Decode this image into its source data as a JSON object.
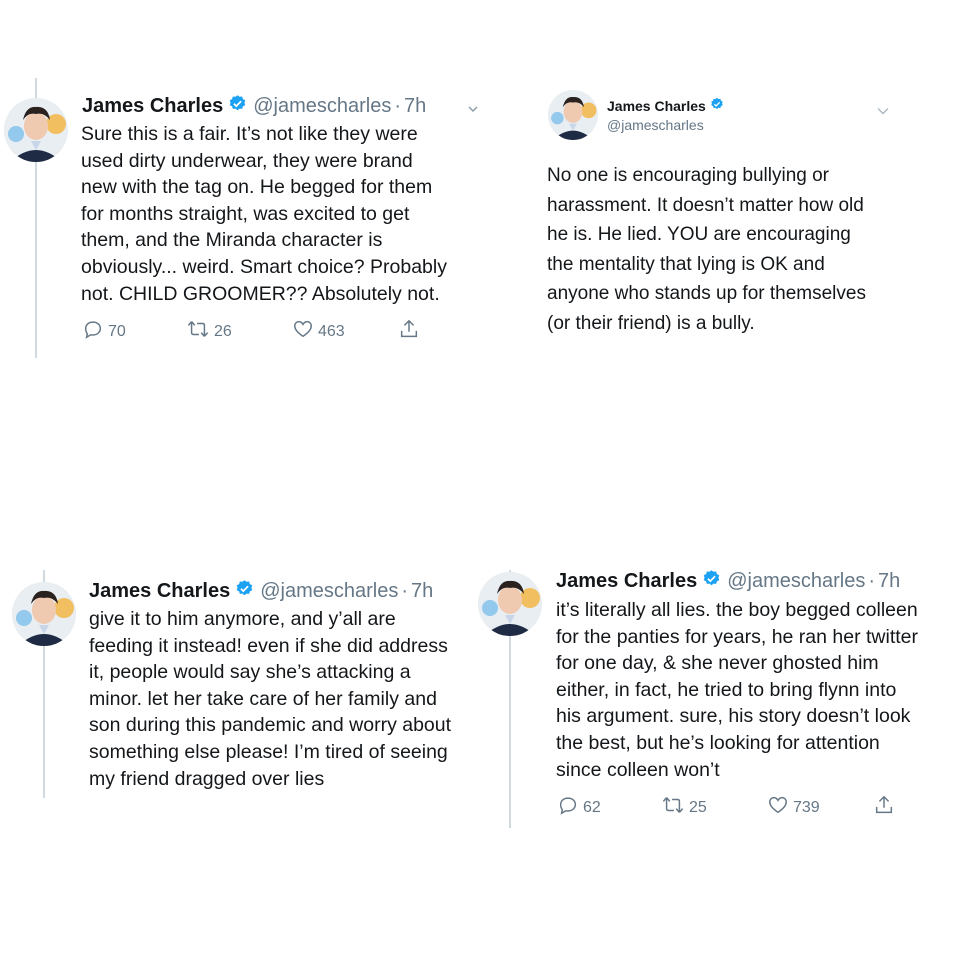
{
  "tweets": [
    {
      "name": "James Charles",
      "handle": "@jamescharles",
      "dot": "·",
      "time": "7h",
      "lines": [
        "Sure this is a fair. It’s not like they were",
        "used dirty underwear, they were brand",
        "new with the tag on. He begged for them",
        "for months straight, was excited to get",
        "them, and the Miranda character is",
        "obviously... weird. Smart choice? Probably",
        "not. CHILD GROOMER?? Absolutely not."
      ],
      "replies": "70",
      "retweets": "26",
      "likes": "463"
    },
    {
      "name": "James Charles",
      "handle": "@jamescharles",
      "lines": [
        "No one is encouraging bullying or",
        "harassment. It doesn’t matter how old",
        "he is. He lied. YOU are encouraging",
        "the mentality that lying is OK and",
        "anyone who stands up for themselves",
        "(or their friend) is a bully."
      ]
    },
    {
      "name": "James Charles",
      "handle": "@jamescharles",
      "dot": "·",
      "time": "7h",
      "lines": [
        "give it to him anymore, and y’all are",
        "feeding it instead! even if she did address",
        "it, people would say she’s attacking a",
        "minor. let her take care of her family and",
        "son during this pandemic and worry about",
        "something else please! I’m tired of seeing",
        "my friend dragged over lies"
      ]
    },
    {
      "name": "James Charles",
      "handle": "@jamescharles",
      "dot": "·",
      "time": "7h",
      "lines": [
        "it’s literally all lies. the boy begged colleen",
        "for the panties for years, he ran her twitter",
        "for one day, & she never ghosted him",
        "either, in fact, he tried to bring flynn into",
        "his argument. sure, his story doesn’t look",
        "the best, but he’s looking for attention",
        "since colleen won’t"
      ],
      "replies": "62",
      "retweets": "25",
      "likes": "739"
    }
  ],
  "colors": {
    "verified": "#1da1f2",
    "muted": "#657786",
    "text": "#14171a",
    "thread_line": "#cfd9de"
  },
  "icons": [
    "reply-icon",
    "retweet-icon",
    "like-icon",
    "share-icon",
    "verified-badge-icon",
    "chevron-down-icon"
  ]
}
